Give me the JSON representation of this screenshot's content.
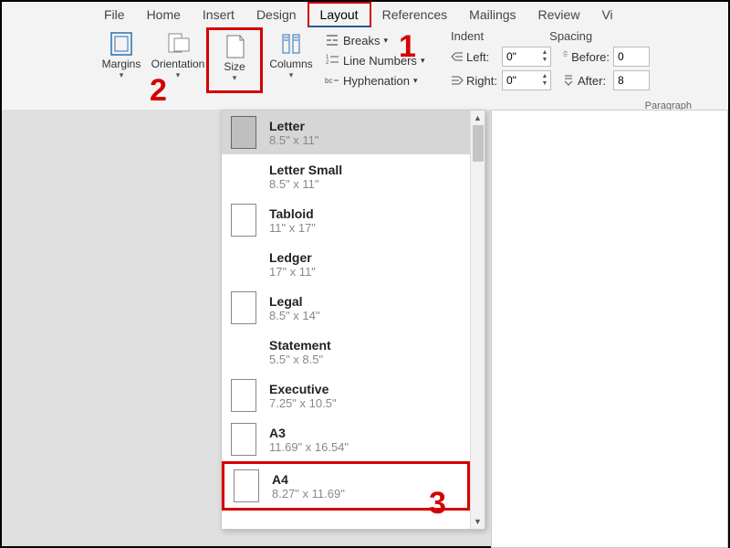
{
  "tabs": [
    "File",
    "Home",
    "Insert",
    "Design",
    "Layout",
    "References",
    "Mailings",
    "Review",
    "Vi"
  ],
  "active_tab": 4,
  "ribbon": {
    "margins": "Margins",
    "orientation": "Orientation",
    "size": "Size",
    "columns": "Columns",
    "breaks": "Breaks",
    "line_numbers": "Line Numbers",
    "hyphenation": "Hyphenation",
    "indent_head": "Indent",
    "spacing_head": "Spacing",
    "left": "Left:",
    "right": "Right:",
    "before": "Before:",
    "after": "After:",
    "left_val": "0\"",
    "right_val": "0\"",
    "before_val": "0",
    "after_val": "8",
    "paragraph": "Paragraph"
  },
  "sizes": [
    {
      "name": "Letter",
      "dim": "8.5\" x 11\"",
      "icon": true,
      "sel": true
    },
    {
      "name": "Letter Small",
      "dim": "8.5\" x 11\"",
      "icon": false
    },
    {
      "name": "Tabloid",
      "dim": "11\" x 17\"",
      "icon": true
    },
    {
      "name": "Ledger",
      "dim": "17\" x 11\"",
      "icon": false
    },
    {
      "name": "Legal",
      "dim": "8.5\" x 14\"",
      "icon": true
    },
    {
      "name": "Statement",
      "dim": "5.5\" x 8.5\"",
      "icon": false
    },
    {
      "name": "Executive",
      "dim": "7.25\" x 10.5\"",
      "icon": true
    },
    {
      "name": "A3",
      "dim": "11.69\" x 16.54\"",
      "icon": true
    },
    {
      "name": "A4",
      "dim": "8.27\" x 11.69\"",
      "icon": true,
      "mark": true
    }
  ],
  "anno": {
    "n1": "1",
    "n2": "2",
    "n3": "3"
  }
}
